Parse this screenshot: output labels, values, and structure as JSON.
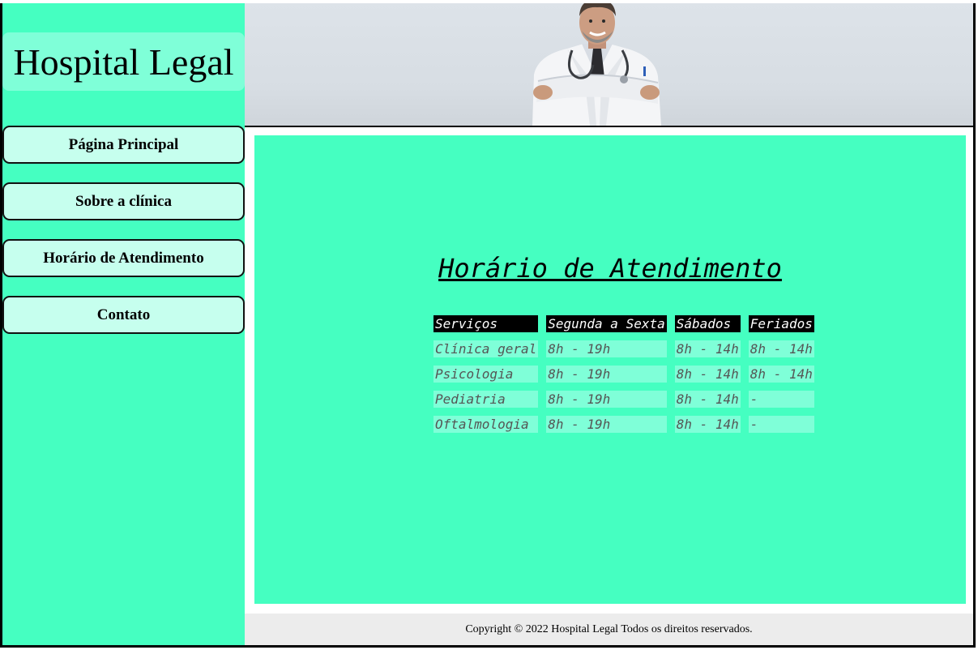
{
  "sidebar": {
    "logo_text": "Hospital Legal",
    "nav": [
      {
        "label": "Página Principal"
      },
      {
        "label": "Sobre a clínica"
      },
      {
        "label": "Horário de Atendimento"
      },
      {
        "label": "Contato"
      }
    ]
  },
  "header": {
    "image": "doctor-photo"
  },
  "main": {
    "heading": "Horário de Atendimento",
    "table": {
      "headers": [
        "Serviços",
        "Segunda a Sexta",
        "Sábados",
        "Feriados"
      ],
      "rows": [
        [
          "Clínica geral",
          "8h - 19h",
          "8h - 14h",
          "8h - 14h"
        ],
        [
          "Psicologia",
          "8h - 19h",
          "8h - 14h",
          "8h - 14h"
        ],
        [
          "Pediatria",
          "8h - 19h",
          "8h - 14h",
          "-"
        ],
        [
          "Oftalmologia",
          "8h - 19h",
          "8h - 14h",
          "-"
        ]
      ]
    }
  },
  "footer": {
    "text": "Copyright © 2022 Hospital Legal Todos os direitos reservados."
  },
  "colors": {
    "accent": "#45ffc1",
    "light_accent": "#7fffd8",
    "nav_bg": "#c6ffee",
    "footer_bg": "#ececec"
  }
}
